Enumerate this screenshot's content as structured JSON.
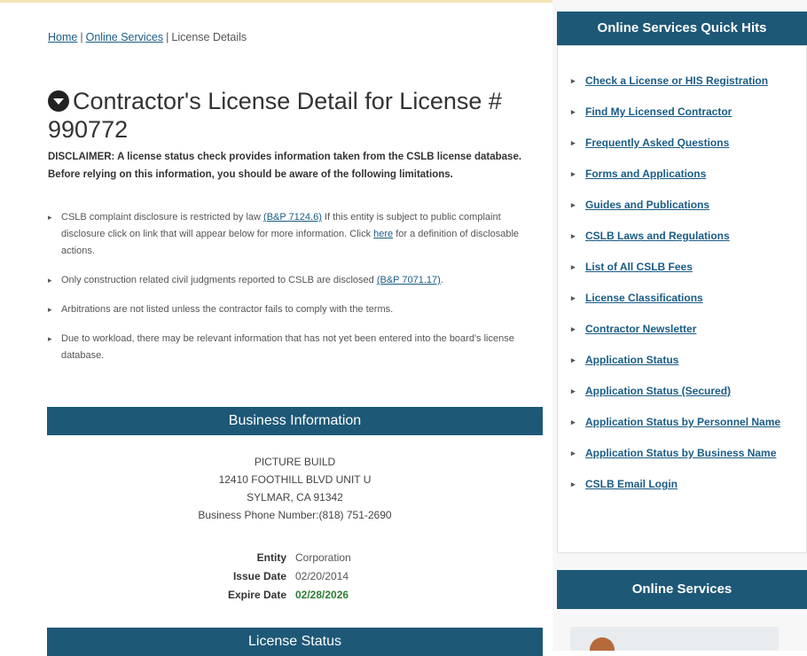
{
  "breadcrumb": {
    "home": "Home",
    "online_services": "Online Services",
    "current": "License Details",
    "separator": "|"
  },
  "page": {
    "title": "Contractor's License Detail for License # 990772",
    "disclaimer": "DISCLAIMER: A license status check provides information taken from the CSLB license database. Before relying on this information, you should be aware of the following limitations.",
    "bullets": {
      "b1_pre": "CSLB complaint disclosure is restricted by law ",
      "b1_link": "(B&P 7124.6)",
      "b1_mid": " If this entity is subject to public complaint disclosure click on link that will appear below for more information. Click ",
      "b1_here": "here",
      "b1_post": " for a definition of disclosable actions.",
      "b2_pre": "Only construction related civil judgments reported to CSLB are disclosed ",
      "b2_link": "(B&P 7071.17)",
      "b2_post": ".",
      "b3": "Arbitrations are not listed unless the contractor fails to comply with the terms.",
      "b4": "Due to workload, there may be relevant information that has not yet been entered into the board's license database."
    }
  },
  "business": {
    "header": "Business Information",
    "name": "PICTURE BUILD",
    "address1": "12410 FOOTHILL BLVD UNIT U",
    "address2": "SYLMAR, CA 91342",
    "phone": "Business Phone Number:(818) 751-2690",
    "entity_label": "Entity",
    "entity_value": "Corporation",
    "issue_label": "Issue Date",
    "issue_value": "02/20/2014",
    "expire_label": "Expire Date",
    "expire_value": "02/28/2026"
  },
  "license_status": {
    "header": "License Status"
  },
  "quick_hits": {
    "header": "Online Services Quick Hits",
    "items": [
      "Check a License or HIS Registration",
      "Find My Licensed Contractor",
      "Frequently Asked Questions",
      "Forms and Applications",
      "Guides and Publications",
      "CSLB Laws and Regulations",
      "List of All CSLB Fees",
      "License Classifications",
      "Contractor Newsletter",
      "Application Status",
      "Application Status (Secured)",
      "Application Status by Personnel Name",
      "Application Status by Business Name",
      "CSLB Email Login"
    ]
  },
  "online_services": {
    "header": "Online Services"
  },
  "colors": {
    "header_bar": "#1e5877",
    "link": "#1a5c86",
    "expire_green": "#2e7d32"
  }
}
